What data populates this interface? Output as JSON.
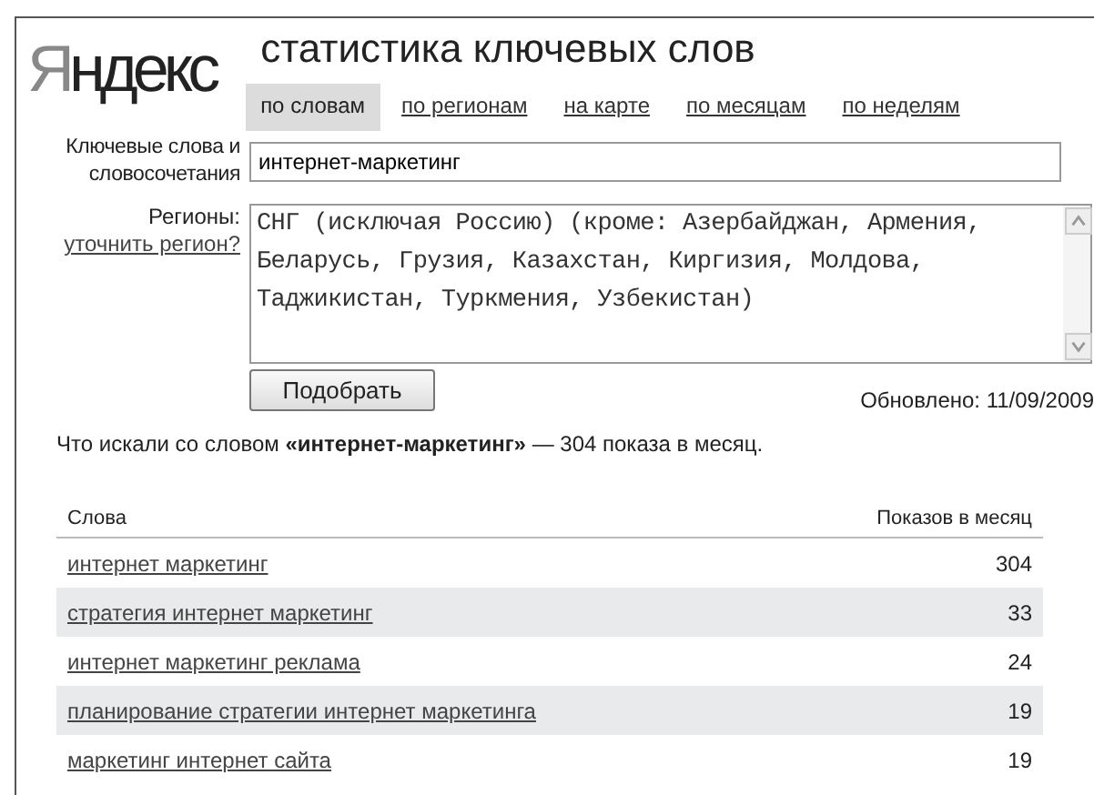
{
  "logo": "Яндекс",
  "title": "статистика ключевых слов",
  "tabs": [
    {
      "label": "по словам",
      "selected": true
    },
    {
      "label": "по регионам",
      "selected": false
    },
    {
      "label": "на карте",
      "selected": false
    },
    {
      "label": "по месяцам",
      "selected": false
    },
    {
      "label": "по неделям",
      "selected": false
    }
  ],
  "keywords": {
    "label": "Ключевые слова и словосочетания",
    "value": "интернет-маркетинг"
  },
  "regions": {
    "label": "Регионы:",
    "link": "уточнить регион?",
    "value": "СНГ (исключая Россию) (кроме: Азербайджан, Армения, Беларусь, Грузия, Казахстан, Киргизия, Молдова, Таджикистан, Туркмения, Узбекистан)"
  },
  "submit": "Подобрать",
  "updated": "Обновлено: 11/09/2009",
  "summary": "Что искали со словом **«интернет-маркетинг»** — 304 показа в месяц.",
  "table": {
    "columns": [
      "Слова",
      "Показов в месяц"
    ],
    "rows": [
      {
        "phrase": "интернет маркетинг",
        "count": "304"
      },
      {
        "phrase": "стратегия интернет маркетинг",
        "count": "33"
      },
      {
        "phrase": "интернет маркетинг реклама",
        "count": "24"
      },
      {
        "phrase": "планирование стратегии интернет маркетинга",
        "count": "19"
      },
      {
        "phrase": "маркетинг интернет сайта",
        "count": "19"
      }
    ]
  }
}
